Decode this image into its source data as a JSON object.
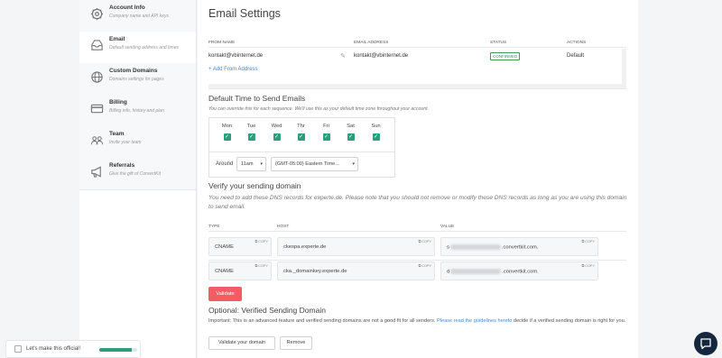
{
  "sidebar": {
    "items": [
      {
        "title": "Account Info",
        "subtitle": "Company name and API keys",
        "icon": "gear-icon"
      },
      {
        "title": "Email",
        "subtitle": "Default sending address and times",
        "icon": "inbox-icon"
      },
      {
        "title": "Custom Domains",
        "subtitle": "Domains settings for pages",
        "icon": "globe-icon"
      },
      {
        "title": "Billing",
        "subtitle": "Billing info, history and plan",
        "icon": "credit-card-icon"
      },
      {
        "title": "Team",
        "subtitle": "Invite your team",
        "icon": "team-icon"
      },
      {
        "title": "Referrals",
        "subtitle": "Give the gift of ConvertKit",
        "icon": "megaphone-icon"
      }
    ]
  },
  "main": {
    "title": "Email Settings",
    "from_table": {
      "headers": [
        "FROM NAME",
        "EMAIL ADDRESS",
        "STATUS",
        "ACTIONS"
      ],
      "row": {
        "name": "kontakt@vbinternet.de",
        "email": "kontakt@vbinternet.de",
        "status": "CONFIRMED",
        "action": "Default"
      },
      "add_label": "+ Add From Address"
    },
    "send_time": {
      "title": "Default Time to Send Emails",
      "description": "You can override this for each sequence. We'll use this as your default time zone throughout your account.",
      "days": [
        "Mon",
        "Tue",
        "Wed",
        "Thr",
        "Fri",
        "Sat",
        "Sun"
      ],
      "around_label": "Around",
      "hour": "11am",
      "timezone": "(GMT-05:00) Eastern Time..."
    },
    "verify": {
      "title": "Verify your sending domain",
      "description": "You need to add these DNS records for experte.de. Please note that you should not remove or modify these DNS records as long as you are using this domain to send email.",
      "headers": [
        "TYPE",
        "HOST",
        "VALUE"
      ],
      "copy_label": "COPY",
      "records": [
        {
          "type": "CNAME",
          "host": "ckespa.experte.de",
          "value_prefix": "s",
          "value_suffix": ".convertkit.com."
        },
        {
          "type": "CNAME",
          "host": "cka._domainkey.experte.de",
          "value_prefix": "d",
          "value_suffix": ".convertkit.com."
        }
      ],
      "validate_label": "Validate"
    },
    "optional": {
      "title": "Optional: Verified Sending Domain",
      "text_before": "Important: This is an advanced feature and verified sending domains are not a good fit for all senders. ",
      "link_text": "Please read the guidelines hereto",
      "text_after": " decide if a verified sending domain is right for you.",
      "validate_domain_label": "Validate your domain",
      "remove_label": "Remove"
    }
  },
  "onboarding": {
    "label": "Let's make this official!",
    "progress": 0.85
  },
  "colors": {
    "accent_green": "#2e9e7a",
    "validate_red": "#f25c65",
    "link_blue": "#4a8ac8",
    "chat_navy": "#14273e"
  }
}
